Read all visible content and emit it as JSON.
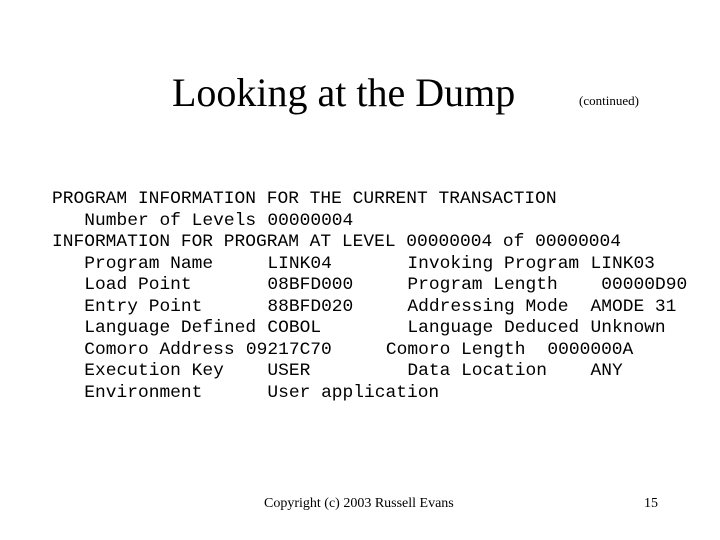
{
  "slide": {
    "title": "Looking at the Dump",
    "subtitle": "(continued)",
    "footer": "Copyright (c) 2003 Russell Evans",
    "page_number": "15"
  },
  "dump": {
    "header1": "PROGRAM INFORMATION FOR THE CURRENT TRANSACTION",
    "levels_label": "Number of Levels",
    "levels_value": "00000004",
    "header2": "INFORMATION FOR PROGRAM AT LEVEL 00000004 of 00000004",
    "fields": [
      {
        "left_label": "Program Name",
        "left_value": "LINK04",
        "right_label": "Invoking Program",
        "right_value": "LINK03"
      },
      {
        "left_label": "Load Point",
        "left_value": "08BFD000",
        "right_label": "Program Length",
        "right_value": "00000D90"
      },
      {
        "left_label": "Entry Point",
        "left_value": "88BFD020",
        "right_label": "Addressing Mode",
        "right_value": "AMODE 31"
      },
      {
        "left_label": "Language Defined",
        "left_value": "COBOL",
        "right_label": "Language Deduced",
        "right_value": "Unknown"
      },
      {
        "left_label": "Comoro Address",
        "left_value": "09217C70",
        "right_label": "Comoro Length",
        "right_value": "0000000A"
      },
      {
        "left_label": "Execution Key",
        "left_value": "USER",
        "right_label": "Data Location",
        "right_value": "ANY"
      },
      {
        "left_label": "Environment",
        "left_value": "User application",
        "right_label": "",
        "right_value": ""
      }
    ]
  }
}
